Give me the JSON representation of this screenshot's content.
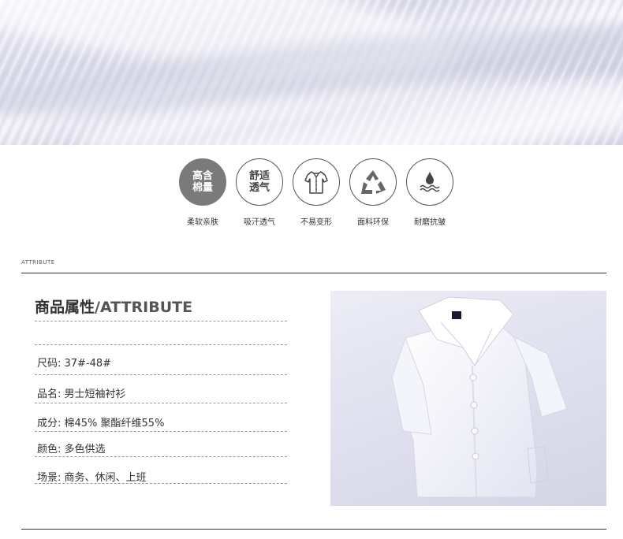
{
  "features": [
    {
      "badge_line1": "高含",
      "badge_line2": "棉量",
      "label": "柔软亲肤",
      "icon": "high-cotton-badge"
    },
    {
      "badge_line1": "舒适",
      "badge_line2": "透气",
      "label": "吸汗透气",
      "icon": "comfort-badge"
    },
    {
      "label": "不易变形",
      "icon": "shirt-icon"
    },
    {
      "label": "面料环保",
      "icon": "recycle-icon"
    },
    {
      "label": "耐磨抗皱",
      "icon": "water-drop-icon"
    }
  ],
  "section": {
    "small_title": "ATTRIBUTE",
    "title_cn": "商品属性",
    "title_en": "/ATTRIBUTE"
  },
  "attributes": [
    {
      "text": "尺码: 37#-48#"
    },
    {
      "text": "品名: 男士短袖衬衫"
    },
    {
      "text": "成分: 棉45% 聚酯纤维55%"
    },
    {
      "text": "颜色: 多色供选"
    },
    {
      "text": "场景: 商务、休闲、上班"
    }
  ],
  "colors": {
    "accent": "#333333",
    "badge_fill": "#7a7a7a"
  }
}
